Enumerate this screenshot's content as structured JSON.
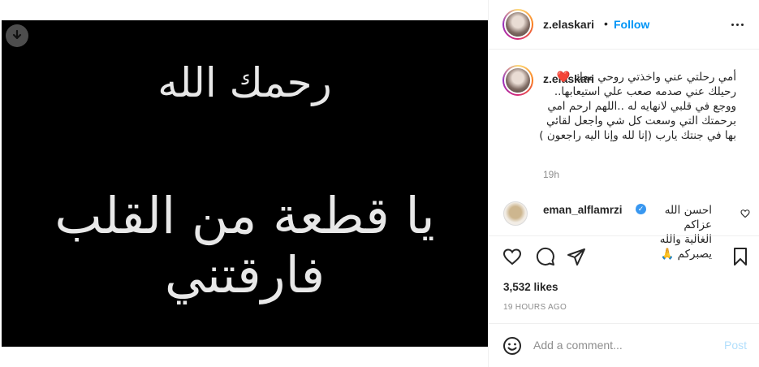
{
  "media": {
    "line1": "رحمك الله",
    "line2": "يا قطعة من القلب فارقتني"
  },
  "header": {
    "username": "z.elaskari",
    "separator": "•",
    "follow_label": "Follow"
  },
  "caption": {
    "username": "z.elaskari",
    "text": "أمي رحلتي عني واخذتي روحي معك ❤️ رحيلك عني صدمه صعب علي استيعابها.. ووجع في قلبي لانهايه له ..اللهم ارحم امي برحمتك التي وسعت كل شي واجعل لقائي بها في جنتك يارب (إنا لله وإنا اليه راجعون )",
    "time": "19h"
  },
  "comments": [
    {
      "username": "eman_alflamrzi",
      "verified": true,
      "text": "احسن الله عزاكم الغالية والله يصبركم 🙏"
    }
  ],
  "stats": {
    "likes": "3,532 likes",
    "posted": "19 HOURS AGO"
  },
  "add_comment": {
    "placeholder": "Add a comment...",
    "post_label": "Post"
  },
  "colors": {
    "accent": "#0095f6",
    "post_disabled": "#b2dffc",
    "verified": "#3897f0",
    "border": "#efefef"
  },
  "icons": [
    "download-icon",
    "more-options-icon",
    "heart-icon",
    "comment-icon",
    "share-icon",
    "bookmark-icon",
    "emoji-icon",
    "verified-badge-icon"
  ]
}
